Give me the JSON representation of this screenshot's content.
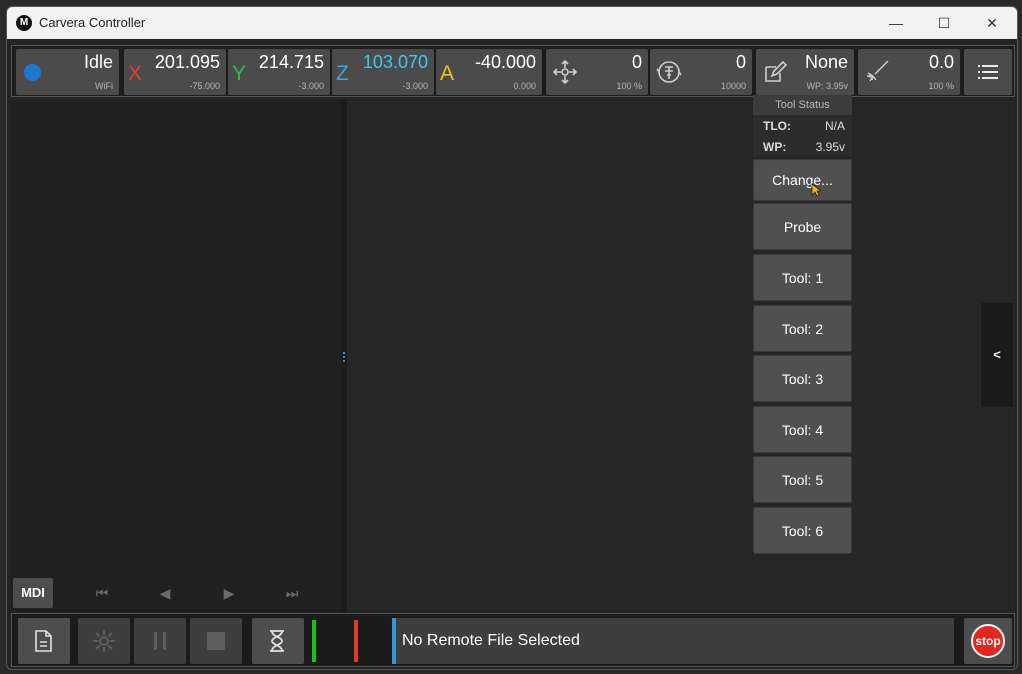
{
  "window": {
    "title": "Carvera Controller",
    "minimize": "—",
    "maximize": "☐",
    "close": "✕"
  },
  "toolbar": {
    "status": {
      "state": "Idle",
      "connection": "WiFi",
      "indicator_color": "#1e78d2"
    },
    "axes": [
      {
        "axis": "X",
        "value": "201.095",
        "work": "-75.000",
        "color": "#e0402d"
      },
      {
        "axis": "Y",
        "value": "214.715",
        "work": "-3.000",
        "color": "#2fbf3a"
      },
      {
        "axis": "Z",
        "value": "103.070",
        "work": "-3.000",
        "color": "#3ea0e0"
      },
      {
        "axis": "A",
        "value": "-40.000",
        "work": "0.000",
        "color": "#f0c020"
      }
    ],
    "feed": {
      "value": "0",
      "override": "100 %"
    },
    "spindle": {
      "value": "0",
      "max": "10000"
    },
    "tool": {
      "value": "None",
      "wp": "WP: 3.95v"
    },
    "laser": {
      "value": "0.0",
      "override": "100 %"
    }
  },
  "tool_status": {
    "header": "Tool Status",
    "tlo_label": "TLO:",
    "tlo_value": "N/A",
    "wp_label": "WP:",
    "wp_value": "3.95v",
    "change": "Change...",
    "probe": "Probe",
    "tools": [
      "Tool: 1",
      "Tool: 2",
      "Tool: 3",
      "Tool: 4",
      "Tool: 5",
      "Tool: 6"
    ]
  },
  "left": {
    "mdi": "MDI",
    "nav": {
      "first": "⏮",
      "prev": "◀",
      "next": "▶",
      "last": "⏭"
    }
  },
  "side_tab": "<",
  "bottom": {
    "file_status": "No Remote File Selected",
    "stop_label": "stop"
  }
}
